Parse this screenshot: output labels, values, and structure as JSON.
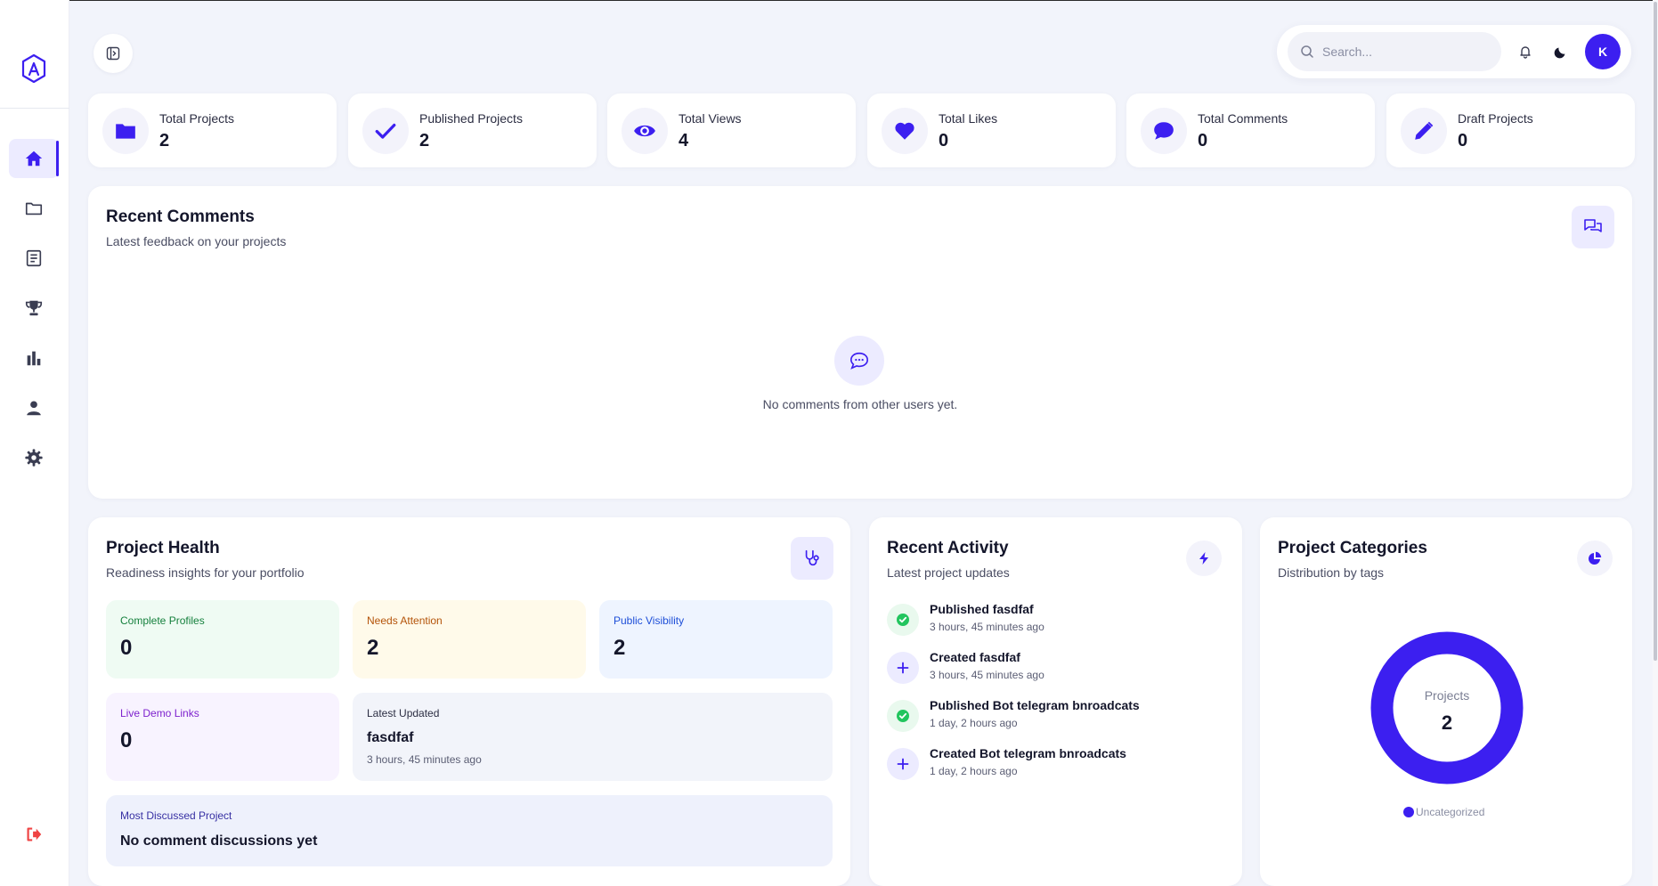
{
  "search": {
    "placeholder": "Search..."
  },
  "user": {
    "initial": "K"
  },
  "stats": [
    {
      "label": "Total Projects",
      "value": "2",
      "icon": "folder-icon"
    },
    {
      "label": "Published Projects",
      "value": "2",
      "icon": "check-icon"
    },
    {
      "label": "Total Views",
      "value": "4",
      "icon": "eye-icon"
    },
    {
      "label": "Total Likes",
      "value": "0",
      "icon": "heart-icon"
    },
    {
      "label": "Total Comments",
      "value": "0",
      "icon": "comment-icon"
    },
    {
      "label": "Draft Projects",
      "value": "0",
      "icon": "pencil-icon"
    }
  ],
  "recent_comments": {
    "title": "Recent Comments",
    "subtitle": "Latest feedback on your projects",
    "empty_text": "No comments from other users yet."
  },
  "project_health": {
    "title": "Project Health",
    "subtitle": "Readiness insights for your portfolio",
    "complete_profiles": {
      "label": "Complete Profiles",
      "value": "0"
    },
    "needs_attention": {
      "label": "Needs Attention",
      "value": "2"
    },
    "public_visibility": {
      "label": "Public Visibility",
      "value": "2"
    },
    "live_demo_links": {
      "label": "Live Demo Links",
      "value": "0"
    },
    "latest_updated": {
      "label": "Latest Updated",
      "name": "fasdfaf",
      "time": "3 hours, 45 minutes ago"
    },
    "most_discussed": {
      "label": "Most Discussed Project",
      "value": "No comment discussions yet"
    }
  },
  "recent_activity": {
    "title": "Recent Activity",
    "subtitle": "Latest project updates",
    "items": [
      {
        "type": "published",
        "title": "Published fasdfaf",
        "time": "3 hours, 45 minutes ago"
      },
      {
        "type": "created",
        "title": "Created fasdfaf",
        "time": "3 hours, 45 minutes ago"
      },
      {
        "type": "published",
        "title": "Published Bot telegram bnroadcats",
        "time": "1 day, 2 hours ago"
      },
      {
        "type": "created",
        "title": "Created Bot telegram bnroadcats",
        "time": "1 day, 2 hours ago"
      }
    ]
  },
  "project_categories": {
    "title": "Project Categories",
    "subtitle": "Distribution by tags",
    "center_label": "Projects",
    "center_value": "2",
    "legend": [
      {
        "name": "Uncategorized",
        "color": "#3c1ff0"
      }
    ]
  },
  "chart_data": {
    "type": "pie",
    "categories": [
      "Uncategorized"
    ],
    "values": [
      2
    ],
    "title": "Project Categories"
  },
  "colors": {
    "accent": "#3c1ff0",
    "success": "#22c55e",
    "danger": "#ef4444"
  }
}
